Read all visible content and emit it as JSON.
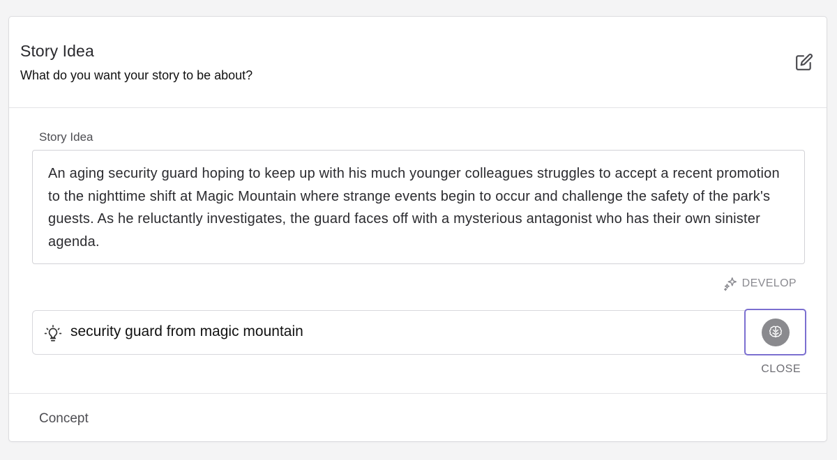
{
  "header": {
    "title": "Story Idea",
    "subtitle": "What do you want your story to be about?",
    "edit_icon": "edit-pencil-icon"
  },
  "story_idea": {
    "label": "Story Idea",
    "text": "An aging security guard hoping to keep up with his much younger colleagues struggles to accept a recent promotion to the nighttime shift at Magic Mountain where strange events begin to occur and challenge the safety of the park's guests. As he reluctantly investigates, the guard faces off with a mysterious antagonist who has their own sinister agenda."
  },
  "develop": {
    "label": "DEVELOP",
    "icon": "sparkles-icon"
  },
  "prompt": {
    "icon": "lightbulb-icon",
    "value": "security guard from magic mountain",
    "submit_icon": "brain-icon",
    "close_label": "CLOSE"
  },
  "concept": {
    "label": "Concept"
  },
  "colors": {
    "accent_border": "#7b6fd0",
    "muted_text": "#8a8a90"
  }
}
